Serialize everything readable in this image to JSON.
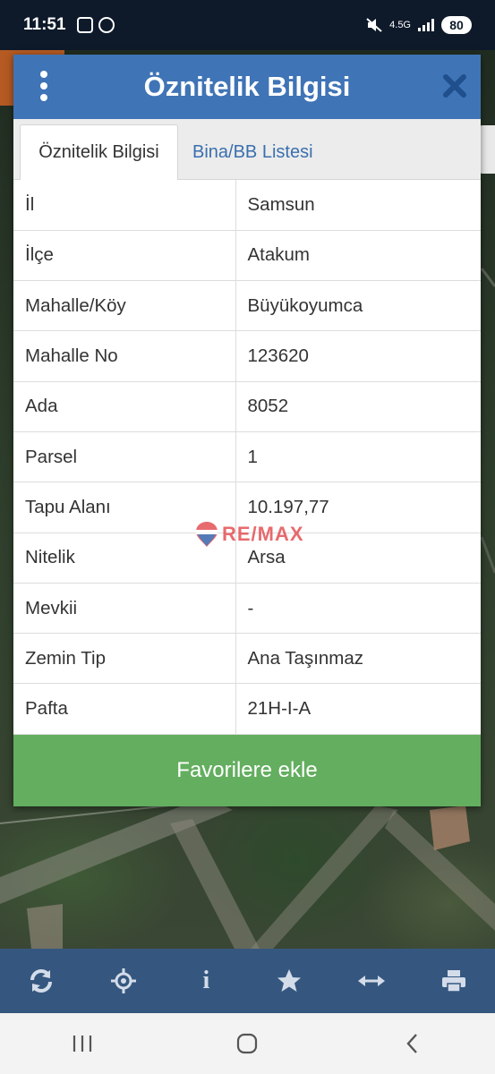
{
  "status_bar": {
    "time": "11:51",
    "network": "4.5G",
    "battery": "80"
  },
  "dialog": {
    "title": "Öznitelik Bilgisi",
    "tabs": [
      {
        "label": "Öznitelik Bilgisi",
        "active": true
      },
      {
        "label": "Bina/BB Listesi",
        "active": false
      }
    ],
    "rows": [
      {
        "key": "İl",
        "value": "Samsun"
      },
      {
        "key": "İlçe",
        "value": "Atakum"
      },
      {
        "key": "Mahalle/Köy",
        "value": "Büyükoyumca"
      },
      {
        "key": "Mahalle No",
        "value": "123620"
      },
      {
        "key": "Ada",
        "value": "8052"
      },
      {
        "key": "Parsel",
        "value": "1"
      },
      {
        "key": "Tapu Alanı",
        "value": "10.197,77"
      },
      {
        "key": "Nitelik",
        "value": "Arsa"
      },
      {
        "key": "Mevkii",
        "value": "-"
      },
      {
        "key": "Zemin Tip",
        "value": "Ana Taşınmaz"
      },
      {
        "key": "Pafta",
        "value": "21H-I-A"
      }
    ],
    "favorite_button": "Favorilere ekle"
  },
  "watermark": {
    "text": "RE/MAX"
  },
  "toolbar": {
    "items": [
      "refresh-icon",
      "locate-icon",
      "info-icon",
      "star-icon",
      "measure-icon",
      "print-icon"
    ]
  },
  "nav": {
    "items": [
      "recent-apps-icon",
      "home-icon",
      "back-icon"
    ]
  },
  "colors": {
    "header": "#3f74b6",
    "favorite": "#63ae5f",
    "toolbar": "#35577f",
    "tab_link": "#3a6fae"
  }
}
